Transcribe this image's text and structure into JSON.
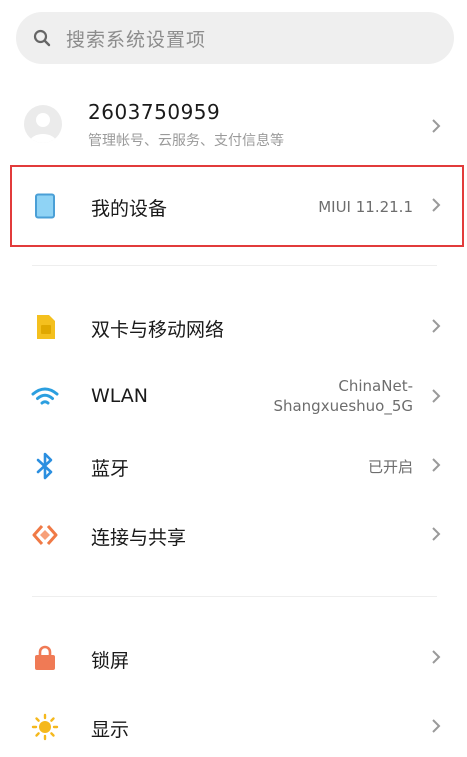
{
  "search": {
    "placeholder": "搜索系统设置项"
  },
  "account": {
    "title": "2603750959",
    "subtitle": "管理帐号、云服务、支付信息等"
  },
  "device": {
    "label": "我的设备",
    "value": "MIUI 11.21.1"
  },
  "network_items": [
    {
      "label": "双卡与移动网络",
      "value": ""
    },
    {
      "label": "WLAN",
      "value_line1": "ChinaNet-",
      "value_line2": "Shangxueshuo_5G"
    },
    {
      "label": "蓝牙",
      "value": "已开启"
    },
    {
      "label": "连接与共享",
      "value": ""
    }
  ],
  "display_items": [
    {
      "label": "锁屏"
    },
    {
      "label": "显示"
    }
  ],
  "icons": {
    "search": "search-icon",
    "device": "device-icon",
    "sim": "sim-card-icon",
    "wlan": "wifi-icon",
    "bluetooth": "bluetooth-icon",
    "share": "connection-share-icon",
    "lock": "lock-icon",
    "display": "sun-icon"
  },
  "colors": {
    "highlight": "#e23b3b",
    "device_icon": "#4a9fd6",
    "sim_icon": "#f4c01e",
    "wifi_icon": "#2b9fe0",
    "bluetooth_icon": "#2b8fe0",
    "share_icon": "#f07a46",
    "lock_icon": "#f07a55",
    "sun_icon": "#f5b81c"
  }
}
